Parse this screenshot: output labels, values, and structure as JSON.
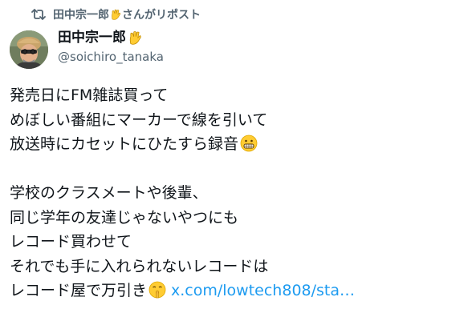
{
  "repost": {
    "icon": "repost-icon",
    "name": "田中宗一郎",
    "suffix": "さんがリポスト"
  },
  "author": {
    "display_name": "田中宗一郎",
    "handle": "@soichiro_tanaka",
    "name_emoji": "vulcan-salute-emoji"
  },
  "tweet": {
    "lines": [
      "発売日にFM雑誌買って",
      "めぼしい番組にマーカーで線を引いて",
      "放送時にカセットにひたすら録音",
      "",
      "学校のクラスメートや後輩、",
      "同じ学年の友達じゃないやつにも",
      "レコード買わせて",
      "それでも手に入れられないレコードは",
      "レコード屋で万引き"
    ],
    "link_text": "x.com/lowtech808/sta…",
    "emoji_line3": "grimacing-face-emoji",
    "emoji_line9": "shushing-face-emoji"
  },
  "colors": {
    "text": "#0f1419",
    "secondary": "#536471",
    "link": "#1d9bf0",
    "emoji_yellow": "#ffcc33"
  }
}
